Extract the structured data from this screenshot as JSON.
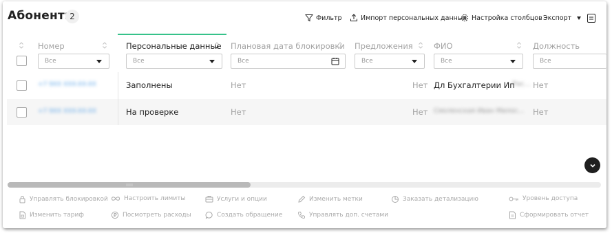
{
  "header": {
    "title": "Абоненты",
    "count": "2",
    "filter_label": "Фильтр",
    "import_label": "Импорт персональных данных",
    "columns_label": "Настройка столбцов",
    "export_label": "Экспорт"
  },
  "table": {
    "columns": [
      {
        "label": "Номер",
        "filter_value": "Все",
        "filter_type": "select"
      },
      {
        "label": "Персональные данные",
        "filter_value": "Все",
        "filter_type": "select"
      },
      {
        "label": "Плановая дата блокировки",
        "filter_value": "Все",
        "filter_type": "date"
      },
      {
        "label": "Предложения",
        "filter_value": "Все",
        "filter_type": "select"
      },
      {
        "label": "ФИО",
        "filter_value": "Все",
        "filter_type": "select"
      },
      {
        "label": "Должность",
        "filter_value": "Все",
        "filter_type": "text"
      }
    ],
    "rows": [
      {
        "number": "+7 9XX XXX-XX-XX",
        "personal_data": "Заполнены",
        "block_date": "Нет",
        "offers": "Нет",
        "fio": "Дл Бухгалтерии Ип",
        "fio_hidden": "Рас...",
        "position": "Нет"
      },
      {
        "number": "+7 9XX XXX-XX-XX",
        "personal_data": "На проверке",
        "block_date": "Нет",
        "offers": "Нет",
        "fio": "",
        "fio_hidden": "Смоленская Иван Милос...",
        "position": "Нет"
      }
    ]
  },
  "actions": [
    {
      "label": "Управлять блокировкой",
      "icon": "lock-icon"
    },
    {
      "label": "Настроить лимиты",
      "icon": "infinity-icon"
    },
    {
      "label": "Услуги и опции",
      "icon": "briefcase-icon"
    },
    {
      "label": "Изменить метки",
      "icon": "pencil-icon"
    },
    {
      "label": "Заказать детализацию",
      "icon": "report-icon"
    },
    {
      "label": "Уровень доступа",
      "icon": "key-icon"
    },
    {
      "label": "Изменить тариф",
      "icon": "sim-icon"
    },
    {
      "label": "Посмотреть расходы",
      "icon": "ruble-icon"
    },
    {
      "label": "Создать обращение",
      "icon": "chat-icon"
    },
    {
      "label": "Управлять доп. счетами",
      "icon": "phone-icon"
    },
    {
      "label": "Сформировать отчет",
      "icon": "document-icon"
    }
  ],
  "colors": {
    "accent": "#37c28a",
    "text_primary": "#222222",
    "text_muted": "#a3a3a3",
    "number_link": "#5fa6e8"
  }
}
